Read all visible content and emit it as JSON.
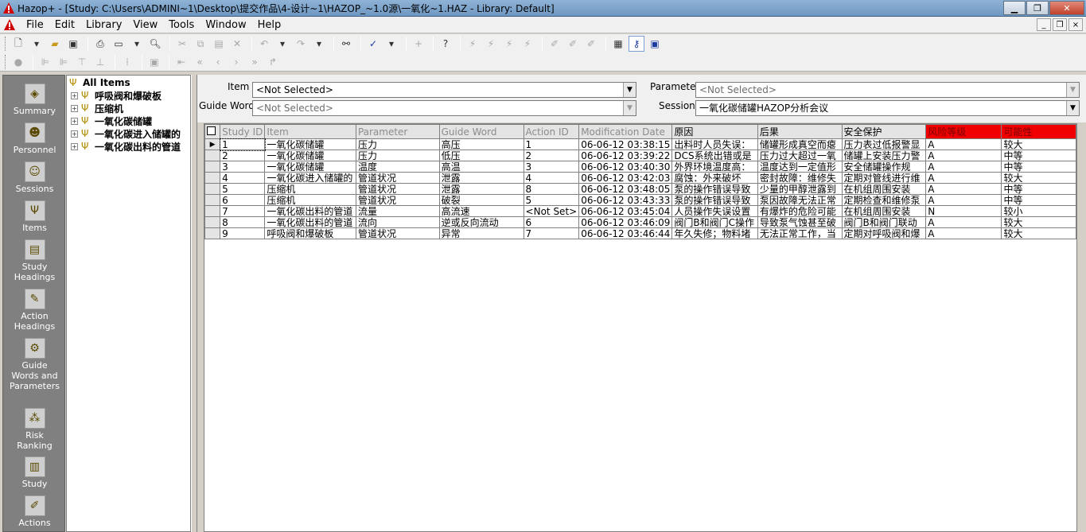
{
  "window": {
    "title": "Hazop+ - [Study: C:\\Users\\ADMINI~1\\Desktop\\提交作品\\4-设计~1\\HAZOP_~1.0源\\一氧化~1.HAZ - Library: Default]",
    "minimize": "▁",
    "maximize": "❐",
    "close": "✕"
  },
  "menu": [
    "File",
    "Edit",
    "Library",
    "View",
    "Tools",
    "Window",
    "Help"
  ],
  "mdi_controls": [
    "_",
    "❐",
    "×"
  ],
  "nav": [
    {
      "label": "Summary",
      "icon": "summary-icon",
      "glyph": "◈"
    },
    {
      "label": "Personnel",
      "icon": "personnel-icon",
      "glyph": "☻"
    },
    {
      "label": "Sessions",
      "icon": "sessions-icon",
      "glyph": "☺"
    },
    {
      "label": "Items",
      "icon": "items-icon",
      "glyph": "Ψ"
    },
    {
      "label": "Study Headings",
      "icon": "study-headings-icon",
      "glyph": "▤"
    },
    {
      "label": "Action Headings",
      "icon": "action-headings-icon",
      "glyph": "✎"
    },
    {
      "label": "Guide Words and Parameters",
      "icon": "guide-words-icon",
      "glyph": "⚙"
    },
    {
      "label": "Risk Ranking",
      "icon": "risk-ranking-icon",
      "glyph": "⁂"
    },
    {
      "label": "Study",
      "icon": "study-icon",
      "glyph": "▥"
    },
    {
      "label": "Actions",
      "icon": "actions-icon",
      "glyph": "✐"
    }
  ],
  "tree": {
    "root": "All Items",
    "items": [
      "呼吸阀和爆破板",
      "压缩机",
      "一氧化碳储罐",
      "一氧化碳进入储罐的",
      "一氧化碳出料的管道"
    ]
  },
  "filters": {
    "item_label": "Item :",
    "item_value": "<Not Selected>",
    "guide_word_label": "Guide Word :",
    "guide_word_value": "<Not Selected>",
    "parameter_label": "Parameter :",
    "parameter_value": "<Not Selected>",
    "session_label": "Session :",
    "session_value": "一氧化碳储罐HAZOP分析会议"
  },
  "grid": {
    "columns": [
      "Study ID",
      "Item",
      "Parameter",
      "Guide Word",
      "Action ID",
      "Modification Date",
      "原因",
      "后果",
      "安全保护",
      "风险等级",
      "可能性"
    ],
    "rows": [
      [
        "1",
        "一氧化碳储罐",
        "压力",
        "高压",
        "1",
        "06-06-12 03:38:15",
        "出料时人员失误：",
        "储罐形成真空而瘪",
        "压力表过低报警显",
        "A",
        "较大"
      ],
      [
        "2",
        "一氧化碳储罐",
        "压力",
        "低压",
        "2",
        "06-06-12 03:39:22",
        "DCS系统出错或是",
        "压力过大超过一氧",
        "储罐上安装压力警",
        "A",
        "中等"
      ],
      [
        "3",
        "一氧化碳储罐",
        "温度",
        "高温",
        "3",
        "06-06-12 03:40:30",
        "外界环境温度高：",
        "温度达到一定值形",
        "安全储罐操作规",
        "A",
        "中等"
      ],
      [
        "4",
        "一氧化碳进入储罐的",
        "管道状况",
        "泄露",
        "4",
        "06-06-12 03:42:03",
        "腐蚀：外来破坏",
        "密封故障：维修失",
        "定期对管线进行维",
        "A",
        "较大"
      ],
      [
        "5",
        "压缩机",
        "管道状况",
        "泄露",
        "8",
        "06-06-12 03:48:05",
        "泵的操作错误导致",
        "少量的甲醇泄露到",
        "在机组周围安装",
        "A",
        "中等"
      ],
      [
        "6",
        "压缩机",
        "管道状况",
        "破裂",
        "5",
        "06-06-12 03:43:33",
        "泵的操作错误导致",
        "泵因故障无法正常",
        "定期检查和维修泵",
        "A",
        "中等"
      ],
      [
        "7",
        "一氧化碳出料的管道",
        "流量",
        "高流速",
        "<Not Set>",
        "06-06-12 03:45:04",
        "人员操作失误设置",
        "有爆炸的危险可能",
        "在机组周围安装",
        "N",
        "较小"
      ],
      [
        "8",
        "一氧化碳出料的管道",
        "流向",
        "逆或反向流动",
        "6",
        "06-06-12 03:46:09",
        "阀门B和阀门C操作",
        "导致泵气蚀甚至破",
        "阀门B和阀门联动",
        "A",
        "较大"
      ],
      [
        "9",
        "呼吸阀和爆破板",
        "管道状况",
        "异常",
        "7",
        "06-06-12 03:46:44",
        "年久失修；物料堵",
        "无法正常工作，当",
        "定期对呼吸阀和爆",
        "A",
        "较大"
      ]
    ]
  },
  "colors": {
    "nav_bg": "#808080",
    "risk_header": "#f00000",
    "titlebar": "#7ea4cc"
  }
}
